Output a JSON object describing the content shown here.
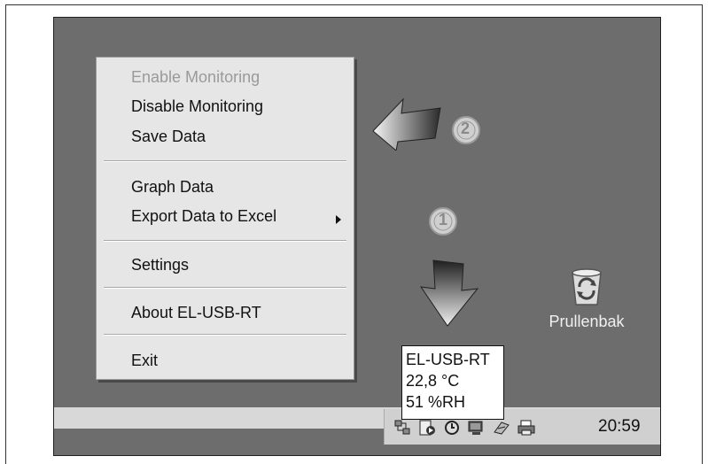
{
  "context_menu": {
    "items": [
      {
        "label": "Enable Monitoring",
        "enabled": false
      },
      {
        "label": "Disable Monitoring",
        "enabled": true
      },
      {
        "label": "Save Data",
        "enabled": true
      },
      {
        "label": "Graph Data",
        "enabled": true
      },
      {
        "label": "Export Data to Excel",
        "enabled": true,
        "submenu": true
      },
      {
        "label": "Settings",
        "enabled": true
      },
      {
        "label": "About EL-USB-RT",
        "enabled": true
      },
      {
        "label": "Exit",
        "enabled": true
      }
    ]
  },
  "tooltip": {
    "device": "EL-USB-RT",
    "temperature": "22,8 °C",
    "humidity": "51 %RH"
  },
  "desktop": {
    "recycle_bin_label": "Prullenbak"
  },
  "taskbar": {
    "clock": "20:59",
    "tray_icons": [
      "network-icon",
      "el-usb-logger-icon",
      "clock-sync-icon",
      "display-icon",
      "connection-icon",
      "printer-icon"
    ]
  },
  "callouts": [
    {
      "number": "1",
      "points_to": "el-usb-logger-icon"
    },
    {
      "number": "2",
      "points_to": "context-menu"
    }
  ],
  "colors": {
    "desktop": "#6d6d6d",
    "menu": "#e6e6e6",
    "taskbar": "#d8d8d8",
    "tooltip": "#ffffff"
  }
}
